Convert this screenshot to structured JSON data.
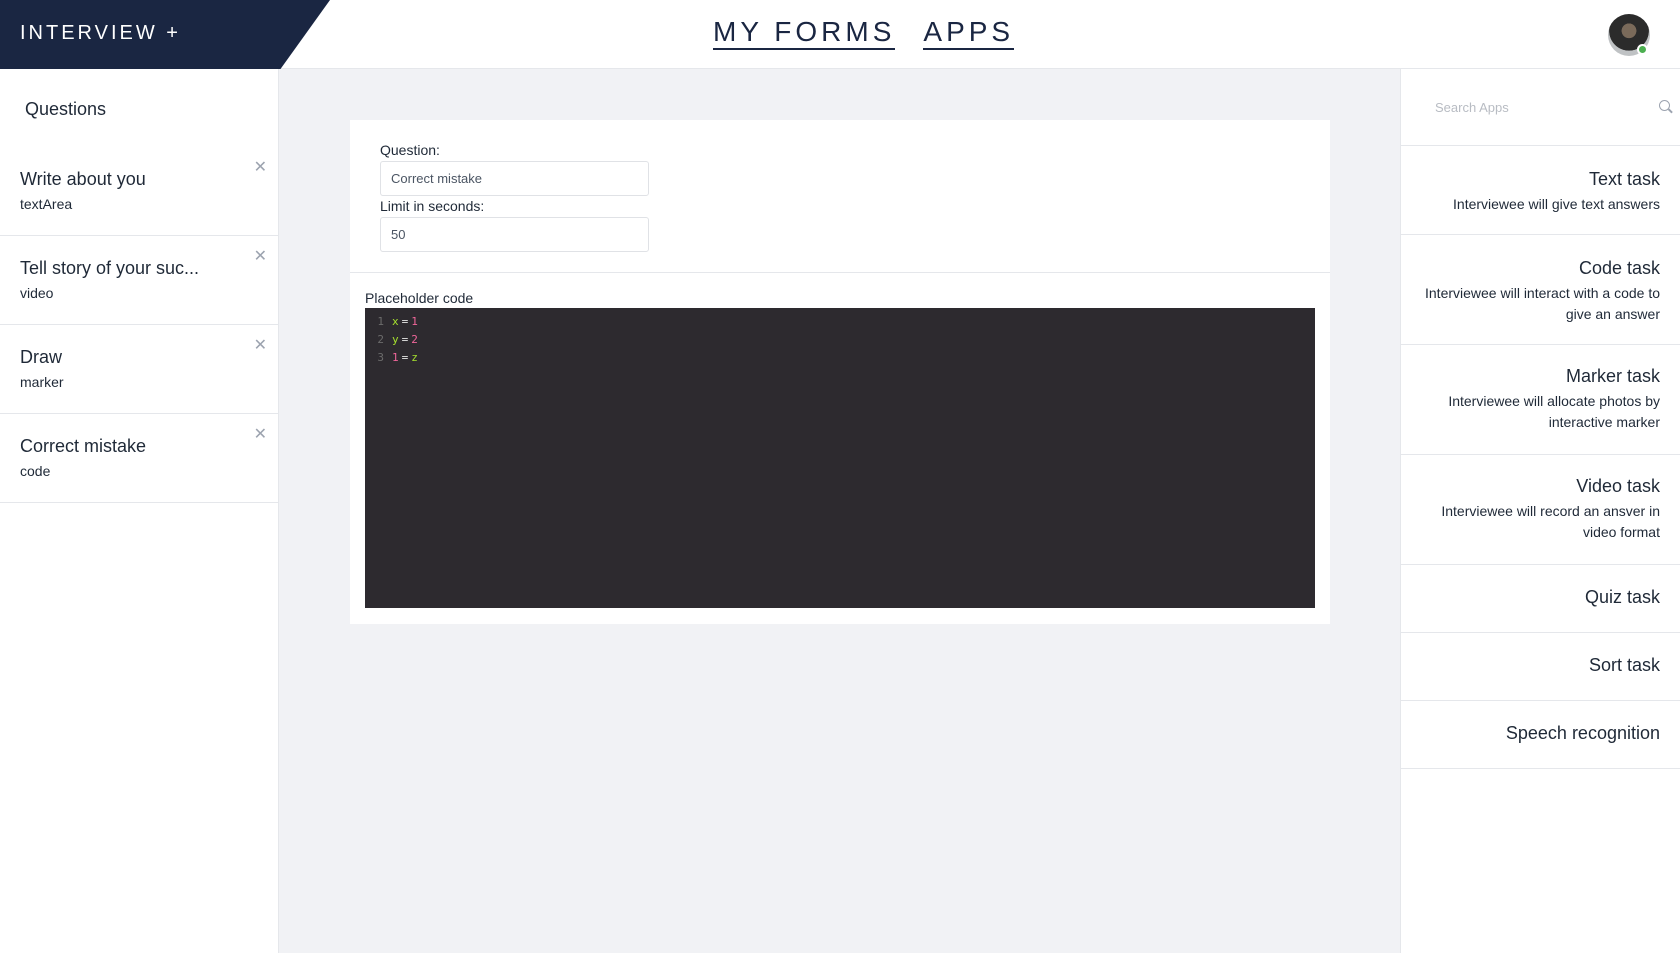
{
  "header": {
    "brand": "INTERVIEW +",
    "nav": [
      "MY FORMS",
      "APPS"
    ]
  },
  "questions": {
    "title": "Questions",
    "items": [
      {
        "title": "Write about you",
        "type": "textArea"
      },
      {
        "title": "Tell story of your suc...",
        "type": "video"
      },
      {
        "title": "Draw",
        "type": "marker"
      },
      {
        "title": "Correct mistake",
        "type": "code"
      }
    ]
  },
  "editor": {
    "question_label": "Question:",
    "question_value": "Correct mistake",
    "limit_label": "Limit in seconds:",
    "limit_value": "50",
    "code_label": "Placeholder code",
    "code_lines": [
      {
        "n": "1",
        "left": "x",
        "op": "=",
        "right": "1"
      },
      {
        "n": "2",
        "left": "y",
        "op": "=",
        "right": "2"
      },
      {
        "n": "3",
        "left": "1",
        "op": "=",
        "right": "z"
      }
    ]
  },
  "apps": {
    "search_placeholder": "Search Apps",
    "items": [
      {
        "title": "Text task",
        "desc": "Interviewee will give text answers"
      },
      {
        "title": "Code task",
        "desc": "Interviewee will interact with a code to give an answer"
      },
      {
        "title": "Marker task",
        "desc": "Interviewee will allocate photos by interactive marker"
      },
      {
        "title": "Video task",
        "desc": "Interviewee will record an ansver in video format"
      },
      {
        "title": "Quiz task",
        "desc": ""
      },
      {
        "title": "Sort task",
        "desc": ""
      },
      {
        "title": "Speech recognition",
        "desc": ""
      }
    ]
  },
  "colors": {
    "brand_bg": "#1a2642",
    "editor_bg": "#2d2a2f",
    "status_online": "#4caf50"
  }
}
